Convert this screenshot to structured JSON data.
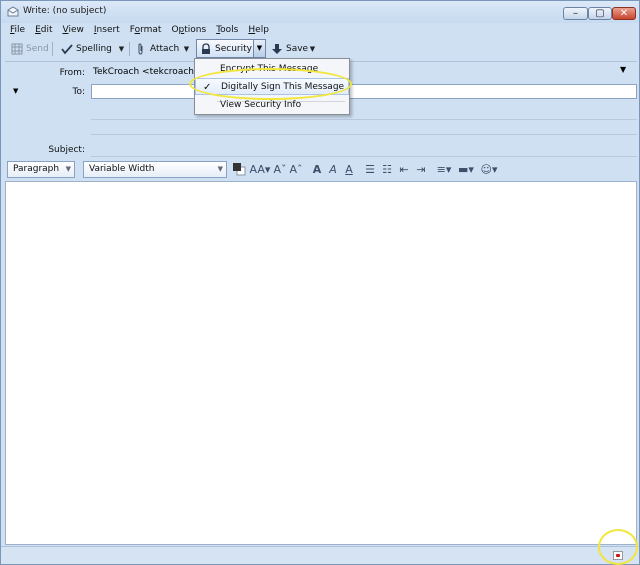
{
  "window": {
    "title": "Write: (no subject)",
    "controls": {
      "minimize": "–",
      "maximize": "▢",
      "close": "✕"
    }
  },
  "menu": [
    {
      "key": "F",
      "rest": "ile"
    },
    {
      "key": "E",
      "rest": "dit"
    },
    {
      "key": "V",
      "rest": "iew"
    },
    {
      "key": "I",
      "rest": "nsert"
    },
    {
      "pre": "F",
      "key": "o",
      "rest": "rmat"
    },
    {
      "pre": "O",
      "key": "p",
      "rest": "tions"
    },
    {
      "key": "T",
      "rest": "ools"
    },
    {
      "key": "H",
      "rest": "elp"
    }
  ],
  "toolbar": {
    "send": "Send",
    "spelling": "Spelling",
    "attach": "Attach",
    "security": "Security",
    "save": "Save"
  },
  "headers": {
    "from_label": "From:",
    "from_value": "TekCroach <tekcroach@",
    "to_label": "To:",
    "subject_label": "Subject:"
  },
  "format": {
    "paragraph": "Paragraph",
    "font": "Variable Width"
  },
  "security_menu": {
    "encrypt": "Encrypt This Message",
    "sign": "Digitally Sign This Message",
    "view_info": "View Security Info"
  },
  "colors": {
    "highlight": "#f2e63a",
    "window_bg": "#cfe0f3"
  }
}
